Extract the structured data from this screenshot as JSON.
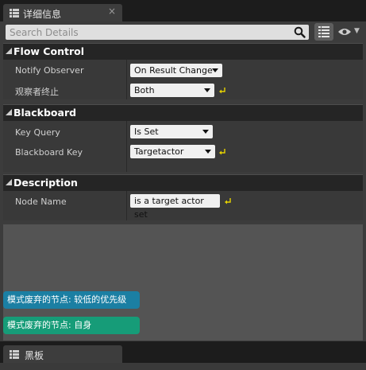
{
  "details_tab": {
    "title": "详细信息",
    "close_glyph": "×"
  },
  "search": {
    "placeholder": "Search Details",
    "value": ""
  },
  "categories": [
    {
      "label": "Flow Control",
      "rows": [
        {
          "name": "Notify Observer",
          "value": "On Result Change",
          "has_dropdown": true,
          "has_reset": false
        },
        {
          "name": "观察者终止",
          "value": "Both",
          "has_dropdown": true,
          "has_reset": true
        }
      ]
    },
    {
      "label": "Blackboard",
      "rows": [
        {
          "name": "Key Query",
          "value": "Is Set",
          "has_dropdown": true,
          "has_reset": false
        },
        {
          "name": "Blackboard Key",
          "value": "Targetactor",
          "has_dropdown": true,
          "has_reset": true
        }
      ]
    },
    {
      "label": "Description",
      "rows": [
        {
          "name": "Node Name",
          "value": "is a target actor set",
          "has_dropdown": false,
          "has_reset": true
        }
      ]
    }
  ],
  "notes": {
    "lower_priority": "模式废弃的节点: 较低的优先级",
    "self": "模式废弃的节点: 自身"
  },
  "bottom_tab": {
    "title": "黑板"
  },
  "icons": {
    "tab": "details-panel-icon",
    "search": "search-icon",
    "view_options": "view-options-grid-icon",
    "visibility": "eye-icon",
    "reset": "reset-to-default-arrow-icon",
    "collapse": "category-caret-icon"
  },
  "colors": {
    "note_blue": "#1b7fa3",
    "note_green": "#169c78",
    "reset_arrow": "#e7d300"
  }
}
